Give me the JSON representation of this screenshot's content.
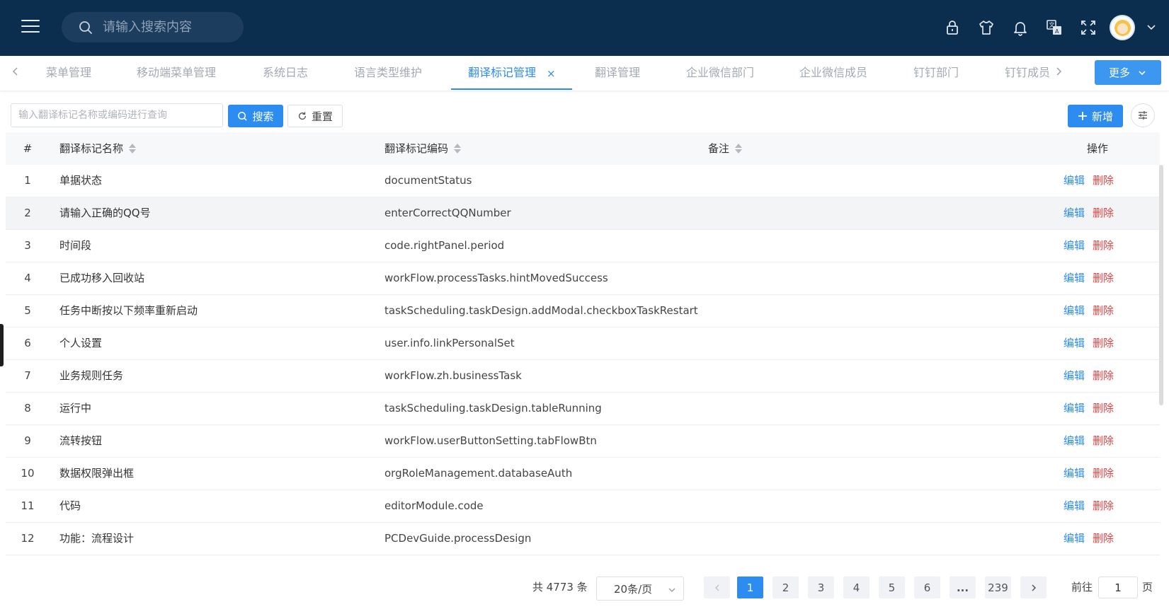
{
  "header": {
    "search_placeholder": "请输入搜索内容",
    "icons": [
      "lock-icon",
      "shirt-icon",
      "bell-icon",
      "translate-icon",
      "fullscreen-icon"
    ],
    "background": "#0b2d4e"
  },
  "tabs": {
    "items": [
      "菜单管理",
      "移动端菜单管理",
      "系统日志",
      "语言类型维护",
      "翻译标记管理",
      "翻译管理",
      "企业微信部门",
      "企业微信成员",
      "钉钉部门",
      "钉钉成员"
    ],
    "active": "翻译标记管理",
    "close": "×",
    "more_label": "更多"
  },
  "toolbar": {
    "query_placeholder": "输入翻译标记名称或编码进行查询",
    "search_label": "搜索",
    "reset_label": "重置",
    "add_label": "新增"
  },
  "table": {
    "headers": {
      "index": "#",
      "name": "翻译标记名称",
      "code": "翻译标记编码",
      "remark": "备注",
      "actions": "操作"
    },
    "edit_label": "编辑",
    "delete_label": "删除",
    "rows": [
      {
        "index": "1",
        "name": "单据状态",
        "code": "documentStatus"
      },
      {
        "index": "2",
        "name": "请输入正确的QQ号",
        "code": "enterCorrectQQNumber"
      },
      {
        "index": "3",
        "name": "时间段",
        "code": "code.rightPanel.period"
      },
      {
        "index": "4",
        "name": "已成功移入回收站",
        "code": "workFlow.processTasks.hintMovedSuccess"
      },
      {
        "index": "5",
        "name": "任务中断按以下频率重新启动",
        "code": "taskScheduling.taskDesign.addModal.checkboxTaskRestart"
      },
      {
        "index": "6",
        "name": "个人设置",
        "code": "user.info.linkPersonalSet"
      },
      {
        "index": "7",
        "name": "业务规则任务",
        "code": "workFlow.zh.businessTask"
      },
      {
        "index": "8",
        "name": "运行中",
        "code": "taskScheduling.taskDesign.tableRunning"
      },
      {
        "index": "9",
        "name": "流转按钮",
        "code": "workFlow.userButtonSetting.tabFlowBtn"
      },
      {
        "index": "10",
        "name": "数据权限弹出框",
        "code": "orgRoleManagement.databaseAuth"
      },
      {
        "index": "11",
        "name": "代码",
        "code": "editorModule.code"
      },
      {
        "index": "12",
        "name": "功能：流程设计",
        "code": "PCDevGuide.processDesign"
      }
    ]
  },
  "pagination": {
    "total": "共 4773 条",
    "page_size": "20条/页",
    "pages": [
      "1",
      "2",
      "3",
      "4",
      "5",
      "6",
      "...",
      "239"
    ],
    "current": "1",
    "goto_label": "前往",
    "goto_value": "1",
    "goto_suffix": "页"
  },
  "colors": {
    "primary": "#2d8cf0",
    "danger": "#ed4040"
  }
}
